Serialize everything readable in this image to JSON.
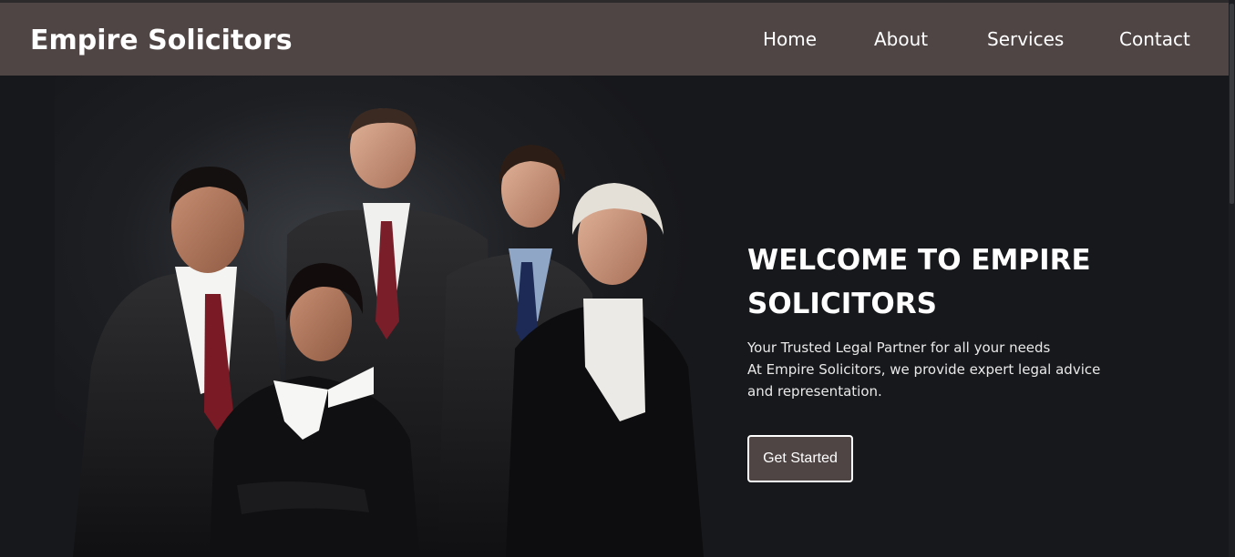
{
  "header": {
    "brand": "Empire Solicitors",
    "nav": [
      "Home",
      "About",
      "Services",
      "Contact"
    ]
  },
  "hero": {
    "headline": "WELCOME TO EMPIRE SOLICITORS",
    "tagline": "Your Trusted Legal Partner for all your needs",
    "description": "At Empire Solicitors, we provide expert legal advice and representation.",
    "cta_label": "Get Started",
    "image": "team-of-five-lawyers-in-suits-photo"
  },
  "colors": {
    "navbar": "#4f4544",
    "background": "#17181b",
    "text": "#ffffff",
    "button": "#4f4544"
  }
}
